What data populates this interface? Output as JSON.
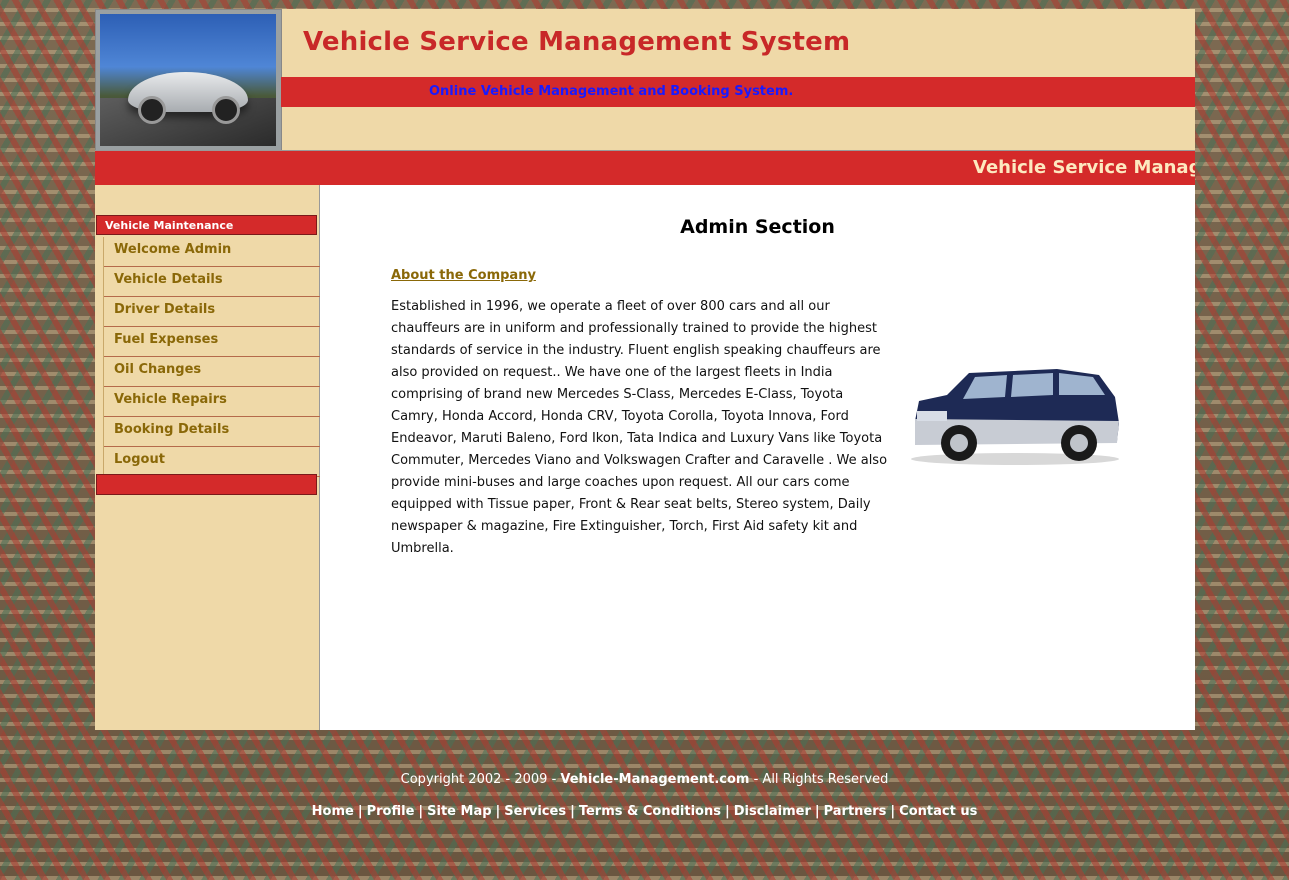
{
  "header": {
    "title": "Vehicle Service Management System",
    "tagline": "Online Vehicle Management and Booking System.",
    "marquee": "Vehicle Service Management System"
  },
  "sidebar": {
    "heading": "Vehicle Maintenance",
    "items": [
      {
        "label": "Welcome Admin"
      },
      {
        "label": "Vehicle Details"
      },
      {
        "label": "Driver Details"
      },
      {
        "label": "Fuel Expenses"
      },
      {
        "label": "Oil Changes"
      },
      {
        "label": "Vehicle Repairs"
      },
      {
        "label": "Booking Details"
      },
      {
        "label": "Logout"
      }
    ]
  },
  "main": {
    "section_title": "Admin Section",
    "about_link": "About the Company",
    "about_text": "Established in 1996, we operate a fleet of over 800 cars and all our chauffeurs are in uniform and professionally trained to provide the highest standards of service in the industry. Fluent english speaking chauffeurs are also provided on request.. We have one of the largest fleets in India comprising of brand new Mercedes S-Class, Mercedes E-Class, Toyota Camry, Honda Accord, Honda CRV, Toyota Corolla, Toyota Innova, Ford Endeavor, Maruti Baleno, Ford Ikon, Tata Indica and Luxury Vans like Toyota Commuter, Mercedes Viano and Volkswagen Crafter and Caravelle . We also provide mini-buses and large coaches upon request. All our cars come equipped with Tissue paper, Front & Rear seat belts, Stereo system, Daily newspaper & magazine, Fire Extinguisher, Torch, First Aid safety kit and Umbrella."
  },
  "footer": {
    "copy_prefix": "Copyright 2002 - 2009 - ",
    "copy_site": "Vehicle-Management.com",
    "copy_suffix": " - All Rights Reserved",
    "links": [
      "Home",
      "Profile",
      "Site Map",
      "Services",
      "Terms & Conditions",
      "Disclaimer",
      "Partners",
      "Contact us"
    ],
    "separator": "|"
  },
  "colors": {
    "accent_red": "#d42a2a",
    "panel_tan": "#efd9a8",
    "link_gold": "#8a6808",
    "tagline_blue": "#1a1aff"
  }
}
